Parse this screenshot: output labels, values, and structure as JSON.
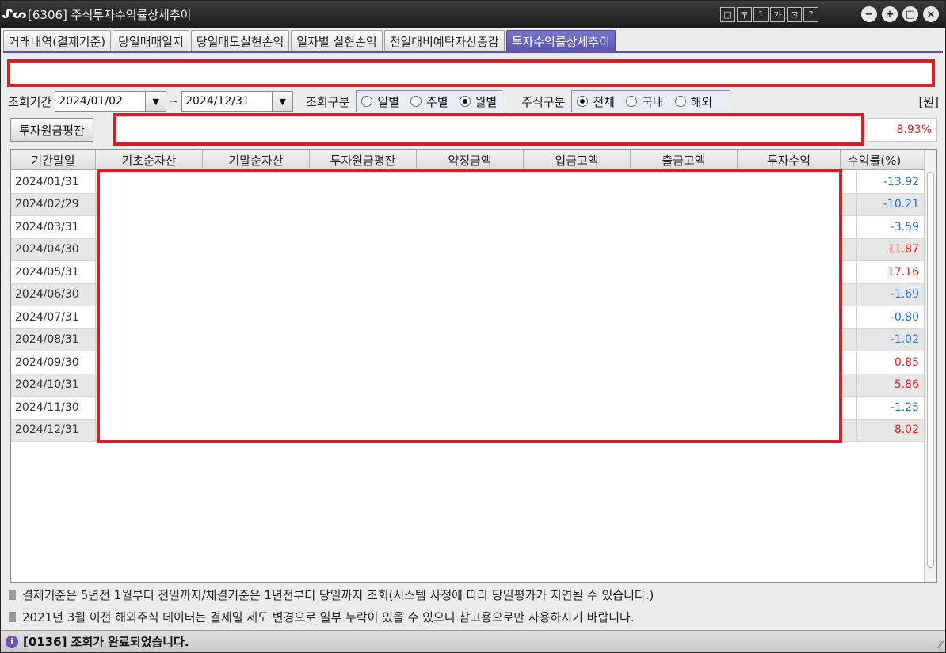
{
  "window": {
    "title": "[6306] 주식투자수익률상세추이",
    "logo": "ᔑᔕ",
    "toolbar_icons": [
      "□",
      "〒",
      "1",
      "가",
      "⊡",
      "?"
    ],
    "controls": [
      "−",
      "+",
      "□",
      "×"
    ]
  },
  "tabs": [
    {
      "label": "거래내역(결제기준)",
      "active": false
    },
    {
      "label": "당일매매일지",
      "active": false
    },
    {
      "label": "당일매도실현손익",
      "active": false
    },
    {
      "label": "일자별 실현손익",
      "active": false
    },
    {
      "label": "전일대비예탁자산증감",
      "active": false
    },
    {
      "label": "투자수익률상세추이",
      "active": true
    }
  ],
  "query": {
    "period_label": "조회기간",
    "start_date": "2024/01/02",
    "tilde": "~",
    "end_date": "2024/12/31",
    "type_label": "조회구분",
    "type_options": [
      {
        "label": "일별",
        "checked": false
      },
      {
        "label": "주별",
        "checked": false
      },
      {
        "label": "월별",
        "checked": true
      }
    ],
    "stock_label": "주식구분",
    "stock_options": [
      {
        "label": "전체",
        "checked": true
      },
      {
        "label": "국내",
        "checked": false
      },
      {
        "label": "해외",
        "checked": false
      }
    ],
    "unit": "[원]"
  },
  "summary": {
    "button_label": "투자원금평잔",
    "yield": "8.93%"
  },
  "grid": {
    "headers": [
      "기간말일",
      "기초순자산",
      "기말순자산",
      "투자원금평잔",
      "약정금액",
      "입금고액",
      "출금고액",
      "투자수익",
      "수익률(%)"
    ],
    "rows": [
      {
        "date": "2024/01/31",
        "yield": "-13.92",
        "sign": "neg"
      },
      {
        "date": "2024/02/29",
        "yield": "-10.21",
        "sign": "neg"
      },
      {
        "date": "2024/03/31",
        "yield": "-3.59",
        "sign": "neg"
      },
      {
        "date": "2024/04/30",
        "yield": "11.87",
        "sign": "pos"
      },
      {
        "date": "2024/05/31",
        "yield": "17.16",
        "sign": "pos"
      },
      {
        "date": "2024/06/30",
        "yield": "-1.69",
        "sign": "neg"
      },
      {
        "date": "2024/07/31",
        "yield": "-0.80",
        "sign": "neg"
      },
      {
        "date": "2024/08/31",
        "yield": "-1.02",
        "sign": "neg"
      },
      {
        "date": "2024/09/30",
        "yield": "0.85",
        "sign": "pos"
      },
      {
        "date": "2024/10/31",
        "yield": "5.86",
        "sign": "pos"
      },
      {
        "date": "2024/11/30",
        "yield": "-1.25",
        "sign": "neg"
      },
      {
        "date": "2024/12/31",
        "yield": "8.02",
        "sign": "pos"
      }
    ]
  },
  "notes": [
    "결제기준은 5년전 1월부터 전일까지/체결기준은 1년전부터 당일까지 조회(시스템 사정에 따라 당일평가가 지연될 수 있습니다.)",
    "2021년 3월 이전 해외주식 데이터는 결제일 제도 변경으로 일부 누락이 있을 수 있으니 참고용으로만 사용하시기 바랍니다."
  ],
  "status": {
    "icon": "i",
    "message": "[0136] 조회가 완료되었습니다."
  },
  "colors": {
    "negative": "#1f6fd6",
    "positive": "#e02020",
    "redaction": "#e01b24",
    "active_tab": "#5b55ad"
  }
}
